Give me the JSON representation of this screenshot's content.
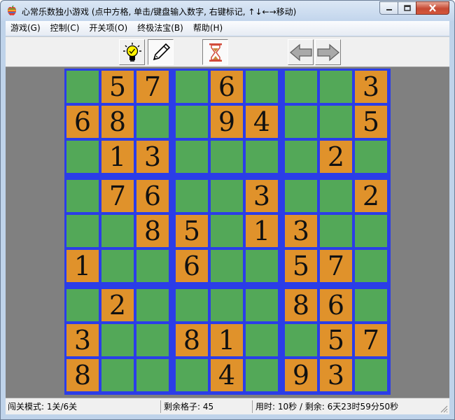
{
  "window": {
    "title": "心常乐数独小游戏    (点中方格, 单击/键盘输入数字, 右键标记, ↑↓←→移动)"
  },
  "menu": [
    "游戏(G)",
    "控制(C)",
    "开关项(O)",
    "终极法宝(B)",
    "帮助(H)"
  ],
  "toolbar": {
    "hint": "lightbulb-icon",
    "pencil": "pencil-icon",
    "timer": "hourglass-icon",
    "undo": "arrow-left-icon",
    "redo": "arrow-right-icon"
  },
  "colors": {
    "grid_line": "#2b3de8",
    "given_cell": "#e0922b",
    "empty_cell": "#53a858",
    "background": "#808080"
  },
  "board": [
    [
      "",
      "5",
      "7",
      "",
      "6",
      "",
      "",
      "",
      "3"
    ],
    [
      "6",
      "8",
      "",
      "",
      "9",
      "4",
      "",
      "",
      "5"
    ],
    [
      "",
      "1",
      "3",
      "",
      "",
      "",
      "",
      "2",
      ""
    ],
    [
      "",
      "7",
      "6",
      "",
      "",
      "3",
      "",
      "",
      "2"
    ],
    [
      "",
      "",
      "8",
      "5",
      "",
      "1",
      "3",
      "",
      ""
    ],
    [
      "1",
      "",
      "",
      "6",
      "",
      "",
      "5",
      "7",
      ""
    ],
    [
      "",
      "2",
      "",
      "",
      "",
      "",
      "8",
      "6",
      ""
    ],
    [
      "3",
      "",
      "",
      "8",
      "1",
      "",
      "",
      "5",
      "7"
    ],
    [
      "8",
      "",
      "",
      "",
      "4",
      "",
      "9",
      "3",
      ""
    ]
  ],
  "status": {
    "mode": "闯关模式: 1关/6关",
    "remaining": "剩余格子: 45",
    "time": "用时: 10秒 / 剩余: 6天23时59分50秒"
  }
}
